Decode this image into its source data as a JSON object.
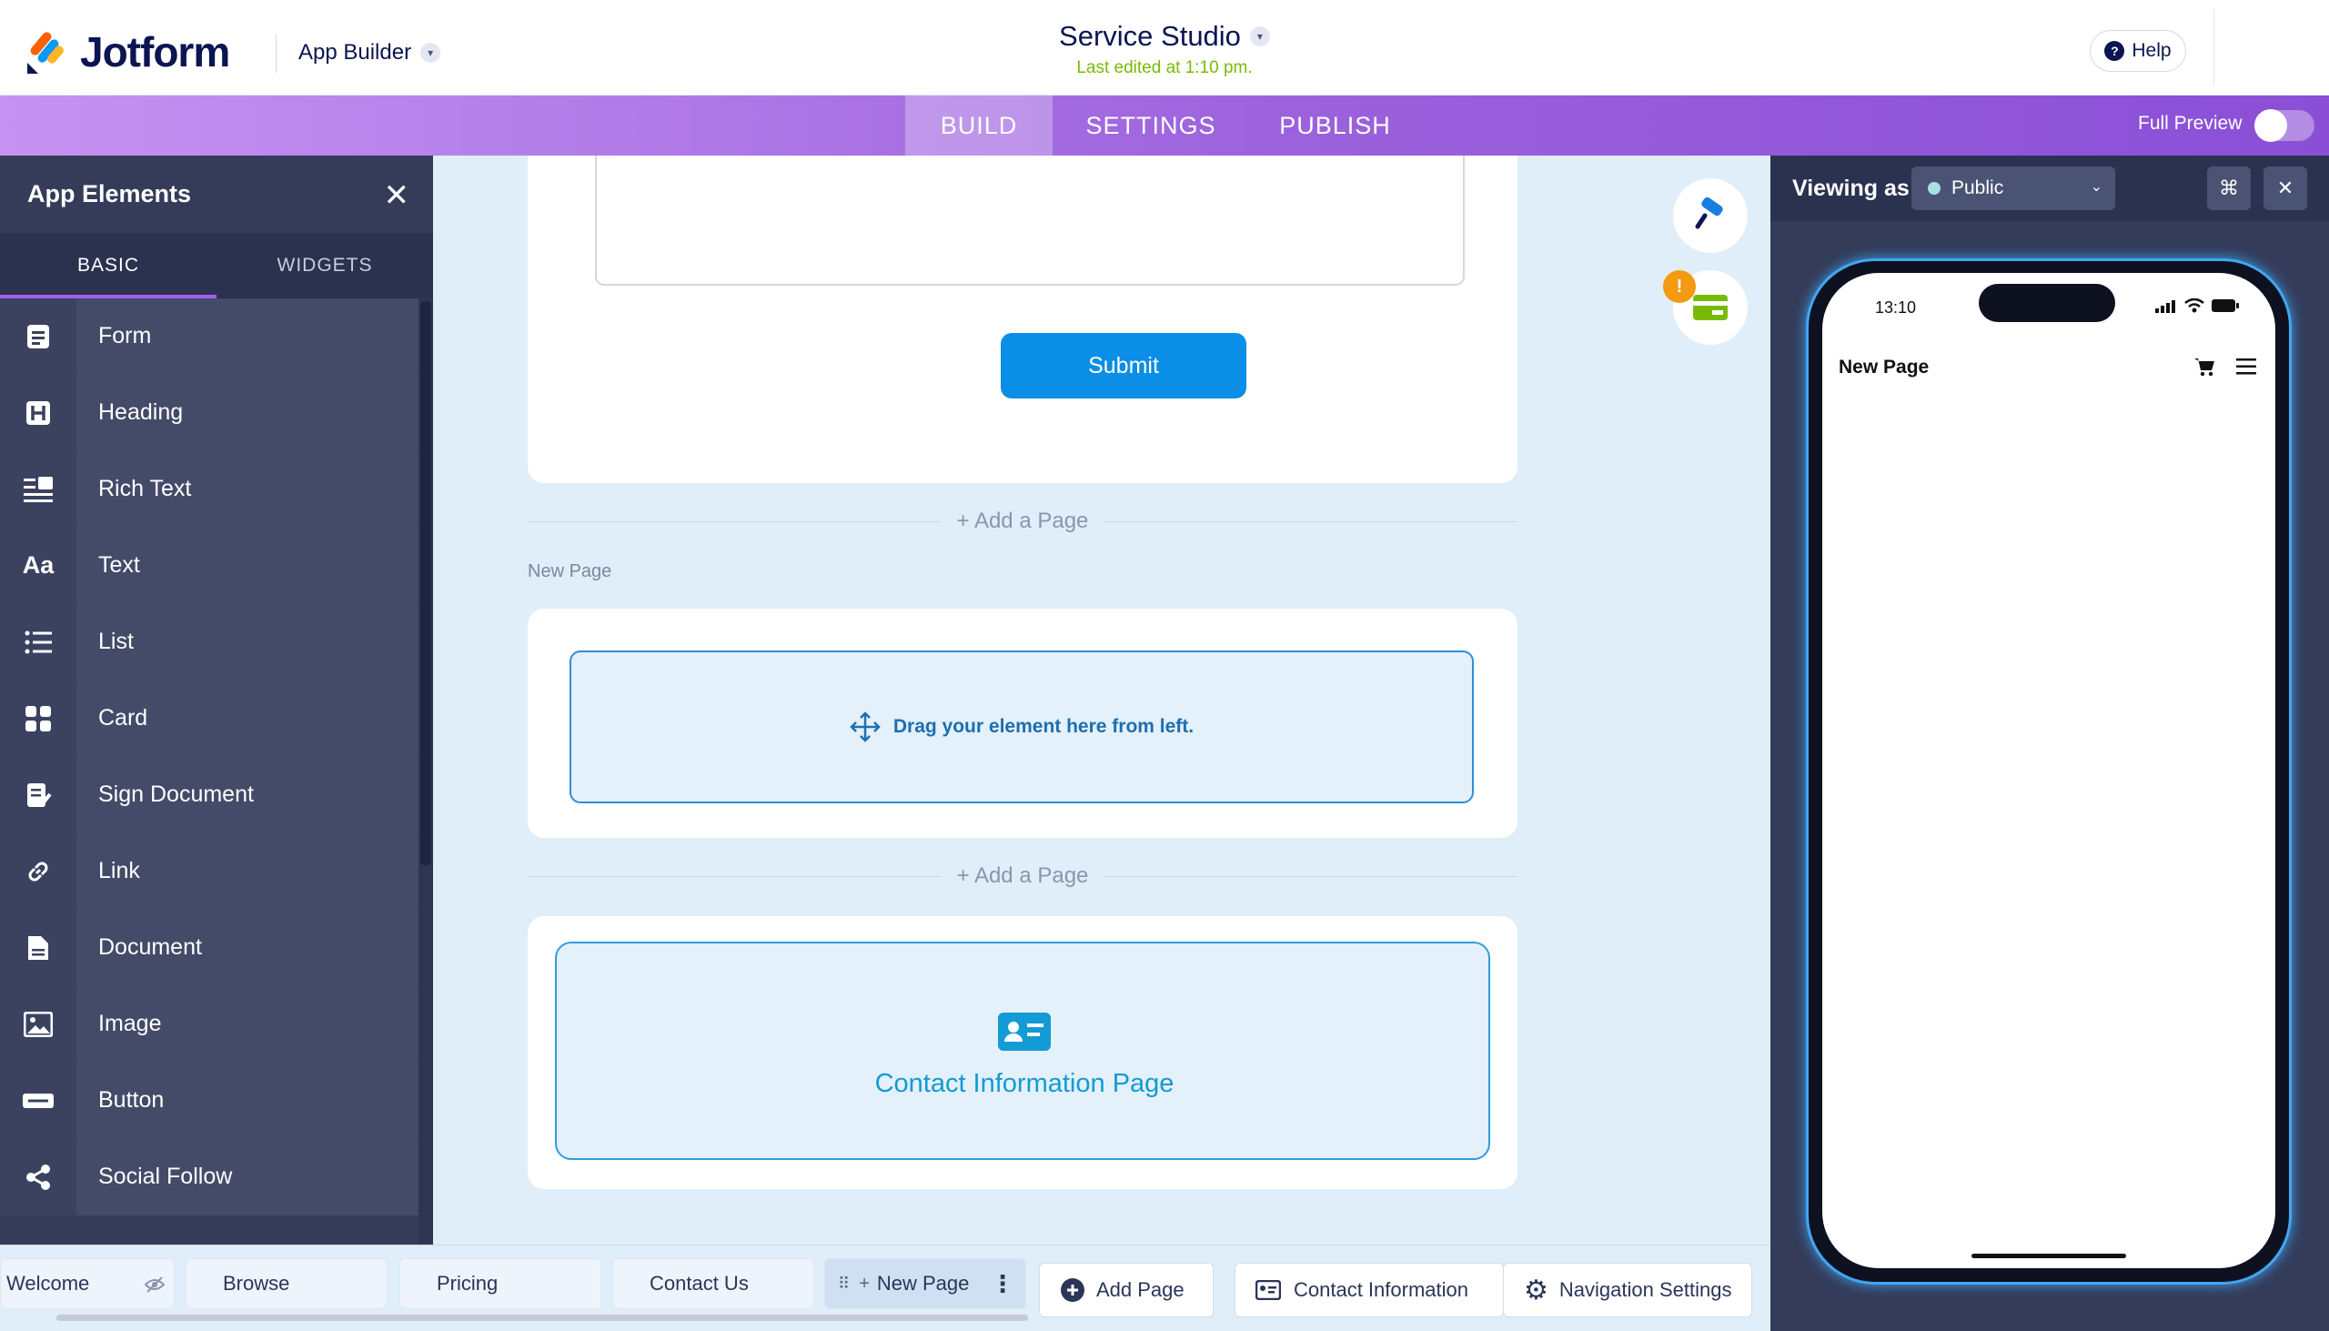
{
  "header": {
    "brand": "Jotform",
    "app_builder": "App Builder",
    "app_title": "Service Studio",
    "last_edited": "Last edited at 1:10 pm.",
    "help": "Help"
  },
  "nav": {
    "tabs": [
      "BUILD",
      "SETTINGS",
      "PUBLISH"
    ],
    "active": "BUILD",
    "full_preview": "Full Preview"
  },
  "elements_panel": {
    "title": "App Elements",
    "tabs": [
      "BASIC",
      "WIDGETS"
    ],
    "items": [
      "Form",
      "Heading",
      "Rich Text",
      "Text",
      "List",
      "Card",
      "Sign Document",
      "Link",
      "Document",
      "Image",
      "Button",
      "Social Follow"
    ]
  },
  "canvas": {
    "submit": "Submit",
    "add_page": "+ Add a Page",
    "new_page_label": "New Page",
    "dropzone_text": "Drag your element here from left.",
    "contact_page": "Contact Information Page"
  },
  "bottom_bar": {
    "pages": [
      "Welcome",
      "Browse",
      "Pricing",
      "Contact Us",
      "New Page"
    ],
    "add_page": "Add Page",
    "contact_information": "Contact Information",
    "navigation_settings": "Navigation Settings"
  },
  "preview": {
    "viewing_as": "Viewing as",
    "role": "Public",
    "time": "13:10",
    "page_title": "New Page"
  },
  "colors": {
    "accent_purple": "#9c62dd",
    "submit_blue": "#0b8ee6",
    "brand_navy": "#0a1551",
    "edited_green": "#78bb07"
  }
}
